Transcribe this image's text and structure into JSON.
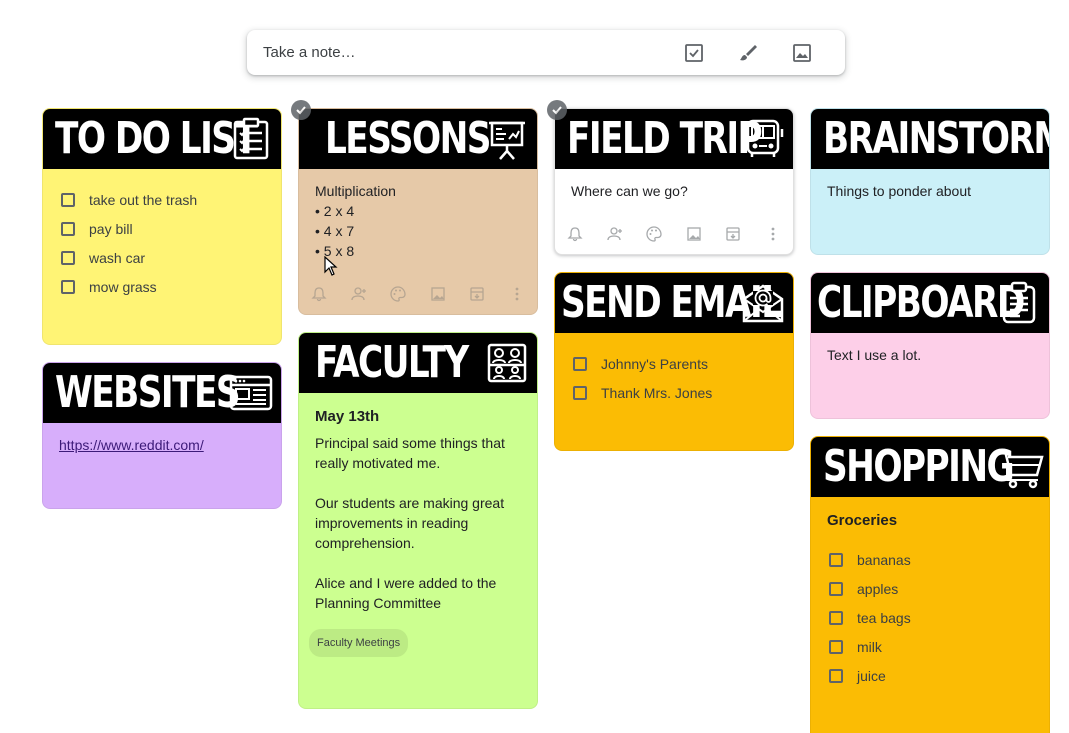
{
  "takenote": {
    "placeholder": "Take a note…"
  },
  "notes": {
    "todo": {
      "title": "TO DO LIST",
      "color": "#fff475",
      "items": [
        "take out the trash",
        "pay bill",
        "wash car",
        "mow grass"
      ]
    },
    "websites": {
      "title": "WEBSITES",
      "color": "#d7aefb",
      "link": "https://www.reddit.com/"
    },
    "lessons": {
      "title": "LESSONS",
      "color": "#e6c9a8",
      "heading": "Multiplication",
      "lines": [
        "• 2 x 4",
        "• 4 x 7",
        "• 5 x 8"
      ]
    },
    "faculty": {
      "title": "FACULTY",
      "color": "#ccff90",
      "heading": "May 13th",
      "p1": "Principal said some things that really motivated me.",
      "p2": "Our students are making great improvements in reading comprehension.",
      "p3": "Alice and I were added to the Planning Committee",
      "label": "Faculty Meetings"
    },
    "fieldtrip": {
      "title": "FIELD TRIP",
      "color": "#ffffff",
      "text": "Where can we go?"
    },
    "sendemail": {
      "title": "SEND EMAIL",
      "color": "#fbbc04",
      "items": [
        "Johnny's Parents",
        "Thank Mrs. Jones"
      ]
    },
    "brainstorm": {
      "title": "BRAINSTORM",
      "color": "#cbf0f8",
      "text": "Things to ponder about"
    },
    "clipboard": {
      "title": "CLIPBOARD",
      "color": "#fdcfe8",
      "text": "Text I use a lot."
    },
    "shopping": {
      "title": "SHOPPING",
      "color": "#fbbc04",
      "heading": "Groceries",
      "items": [
        "bananas",
        "apples",
        "tea bags",
        "milk",
        "juice"
      ]
    }
  },
  "icons": {
    "takenote_tools": [
      "checkbox-icon",
      "brush-icon",
      "image-icon"
    ],
    "note_toolbar": [
      "bell-icon",
      "collaborator-icon",
      "palette-icon",
      "image-icon",
      "archive-icon",
      "more-icon"
    ]
  }
}
